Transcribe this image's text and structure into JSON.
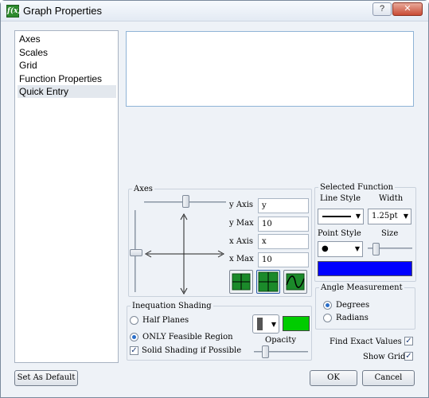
{
  "window": {
    "title": "Graph Properties",
    "app_icon_text": "f(x)",
    "help_label": "?",
    "close_label": "✕"
  },
  "nav": {
    "items": [
      {
        "label": "Axes",
        "selected": false
      },
      {
        "label": "Scales",
        "selected": false
      },
      {
        "label": "Grid",
        "selected": false
      },
      {
        "label": "Function Properties",
        "selected": false
      },
      {
        "label": "Quick Entry",
        "selected": true
      }
    ]
  },
  "quick_entry": {
    "value": ""
  },
  "axes": {
    "legend": "Axes",
    "y_axis_label": "y Axis",
    "y_axis_value": "y",
    "y_max_label": "y Max",
    "y_max_value": "10",
    "x_axis_label": "x Axis",
    "x_axis_value": "x",
    "x_max_label": "x Max",
    "x_max_value": "10",
    "grid_color": "#1b8a2a"
  },
  "selected_function": {
    "legend": "Selected Function",
    "line_style_label": "Line Style",
    "width_label": "Width",
    "width_value": "1.25pt",
    "point_style_label": "Point Style",
    "point_style_value": "●",
    "size_label": "Size",
    "color": "#0000ff"
  },
  "angle": {
    "legend": "Angle Measurement",
    "degrees_label": "Degrees",
    "radians_label": "Radians",
    "selected": "Degrees"
  },
  "inequation": {
    "legend": "Inequation Shading",
    "half_planes_label": "Half Planes",
    "only_feasible_label": "ONLY Feasible Region",
    "selected": "ONLY Feasible Region",
    "solid_shading_label": "Solid Shading if Possible",
    "solid_shading_checked": true,
    "opacity_label": "Opacity",
    "shade_color": "#00cc00"
  },
  "options": {
    "find_exact_label": "Find Exact Values",
    "find_exact_checked": true,
    "show_grid_label": "Show Grid",
    "show_grid_checked": true
  },
  "buttons": {
    "set_default": "Set As Default",
    "ok": "OK",
    "cancel": "Cancel"
  }
}
